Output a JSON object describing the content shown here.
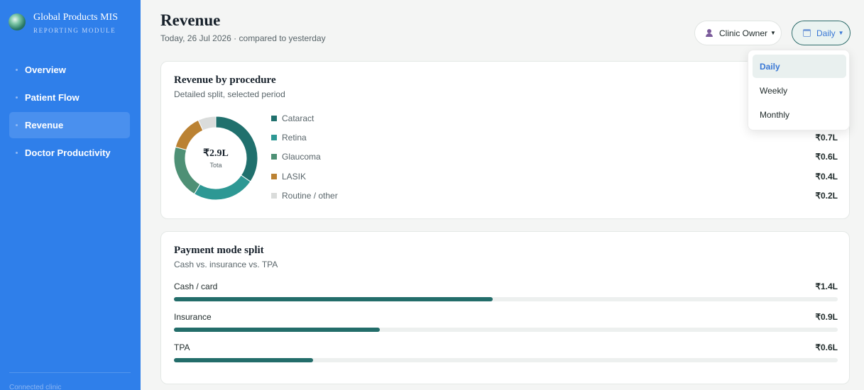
{
  "brand": {
    "title": "Global Products MIS",
    "subtitle": "REPORTING MODULE"
  },
  "sidebar": {
    "items": [
      {
        "label": "Overview",
        "active": false
      },
      {
        "label": "Patient Flow",
        "active": false
      },
      {
        "label": "Revenue",
        "active": true
      },
      {
        "label": "Doctor Productivity",
        "active": false
      }
    ],
    "footer": "Connected clinic"
  },
  "header": {
    "title": "Revenue",
    "subtitle": "Today, 26 Jul 2026 · compared to yesterday",
    "role_selector": {
      "label": "Clinic Owner",
      "icon": "person-icon"
    },
    "period_selector": {
      "label": "Daily",
      "icon": "calendar-icon"
    }
  },
  "period_dropdown": {
    "options": [
      "Daily",
      "Weekly",
      "Monthly"
    ],
    "selected": "Daily"
  },
  "procedure_card": {
    "title": "Revenue by procedure",
    "subtitle": "Detailed split, selected period",
    "total_value": "₹2.9L",
    "total_label": "Tota",
    "items": [
      {
        "label": "Cataract",
        "value": "",
        "amount": 1.0,
        "color": "#20706d"
      },
      {
        "label": "Retina",
        "value": "₹0.7L",
        "amount": 0.7,
        "color": "#2e9894"
      },
      {
        "label": "Glaucoma",
        "value": "₹0.6L",
        "amount": 0.6,
        "color": "#4e9075"
      },
      {
        "label": "LASIK",
        "value": "₹0.4L",
        "amount": 0.4,
        "color": "#bb8233"
      },
      {
        "label": "Routine / other",
        "value": "₹0.2L",
        "amount": 0.2,
        "color": "#dadcdb"
      }
    ]
  },
  "payment_card": {
    "title": "Payment mode split",
    "subtitle": "Cash vs. insurance vs. TPA",
    "items": [
      {
        "label": "Cash / card",
        "value": "₹1.4L",
        "share": 0.48
      },
      {
        "label": "Insurance",
        "value": "₹0.9L",
        "share": 0.31
      },
      {
        "label": "TPA",
        "value": "₹0.6L",
        "share": 0.21
      }
    ]
  }
}
